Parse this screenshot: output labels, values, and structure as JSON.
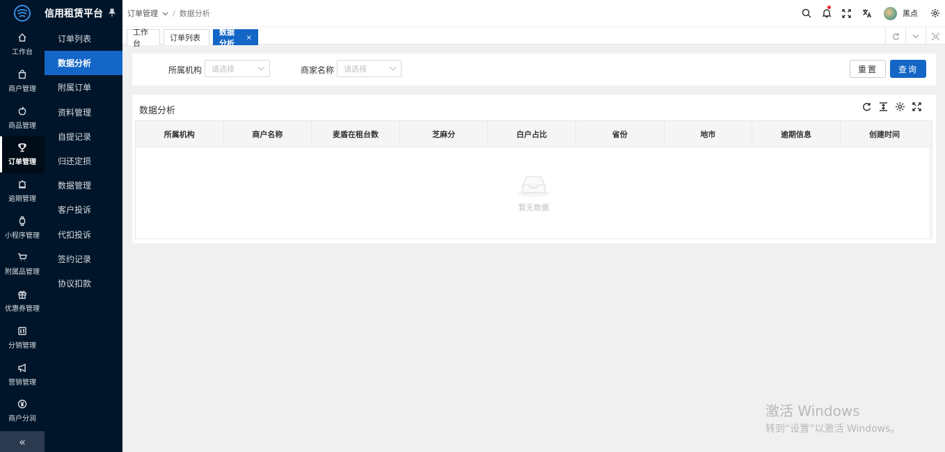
{
  "app": {
    "title": "信用租赁平台"
  },
  "rail": [
    {
      "label": "工作台",
      "icon": "home-icon"
    },
    {
      "label": "商户管理",
      "icon": "bag-icon"
    },
    {
      "label": "商品管理",
      "icon": "apple-icon"
    },
    {
      "label": "订单管理",
      "icon": "trophy-icon",
      "active": true
    },
    {
      "label": "逾期管理",
      "icon": "alarm-icon"
    },
    {
      "label": "小程序管理",
      "icon": "watch-icon"
    },
    {
      "label": "附属品管理",
      "icon": "cart-icon"
    },
    {
      "label": "优惠券管理",
      "icon": "gift-icon"
    },
    {
      "label": "分销管理",
      "icon": "sliders-icon"
    },
    {
      "label": "营销管理",
      "icon": "megaphone-icon"
    },
    {
      "label": "商户分润",
      "icon": "yen-icon"
    }
  ],
  "collapse_icon": "double-chevron-left-icon",
  "submenu": {
    "items": [
      "订单列表",
      "数据分析",
      "附属订单",
      "资料管理",
      "自提记录",
      "归还定损",
      "数据管理",
      "客户投诉",
      "代扣投诉",
      "签约记录",
      "协议扣款"
    ],
    "active_index": 1
  },
  "header": {
    "breadcrumb": {
      "parent": "订单管理",
      "separator": "/",
      "current": "数据分析"
    },
    "username": "黑点"
  },
  "tabs": [
    {
      "label": "工作台"
    },
    {
      "label": "订单列表"
    },
    {
      "label": "数据分析",
      "active": true,
      "close": "×"
    }
  ],
  "filter": {
    "org_label": "所属机构",
    "org_placeholder": "请选择",
    "merchant_label": "商家名称",
    "merchant_placeholder": "请选择",
    "reset_label": "重置",
    "query_label": "查询"
  },
  "table": {
    "title": "数据分析",
    "columns": [
      "所属机构",
      "商户名称",
      "麦盾在租台数",
      "芝麻分",
      "白户占比",
      "省份",
      "地市",
      "逾期信息",
      "创建时间"
    ],
    "empty_text": "暂无数据"
  },
  "watermark": {
    "line1": "激活 Windows",
    "line2": "转到“设置”以激活 Windows。"
  },
  "colors": {
    "primary": "#1366c6",
    "sidebar": "#001529",
    "notification_dot": "#f5222d"
  }
}
